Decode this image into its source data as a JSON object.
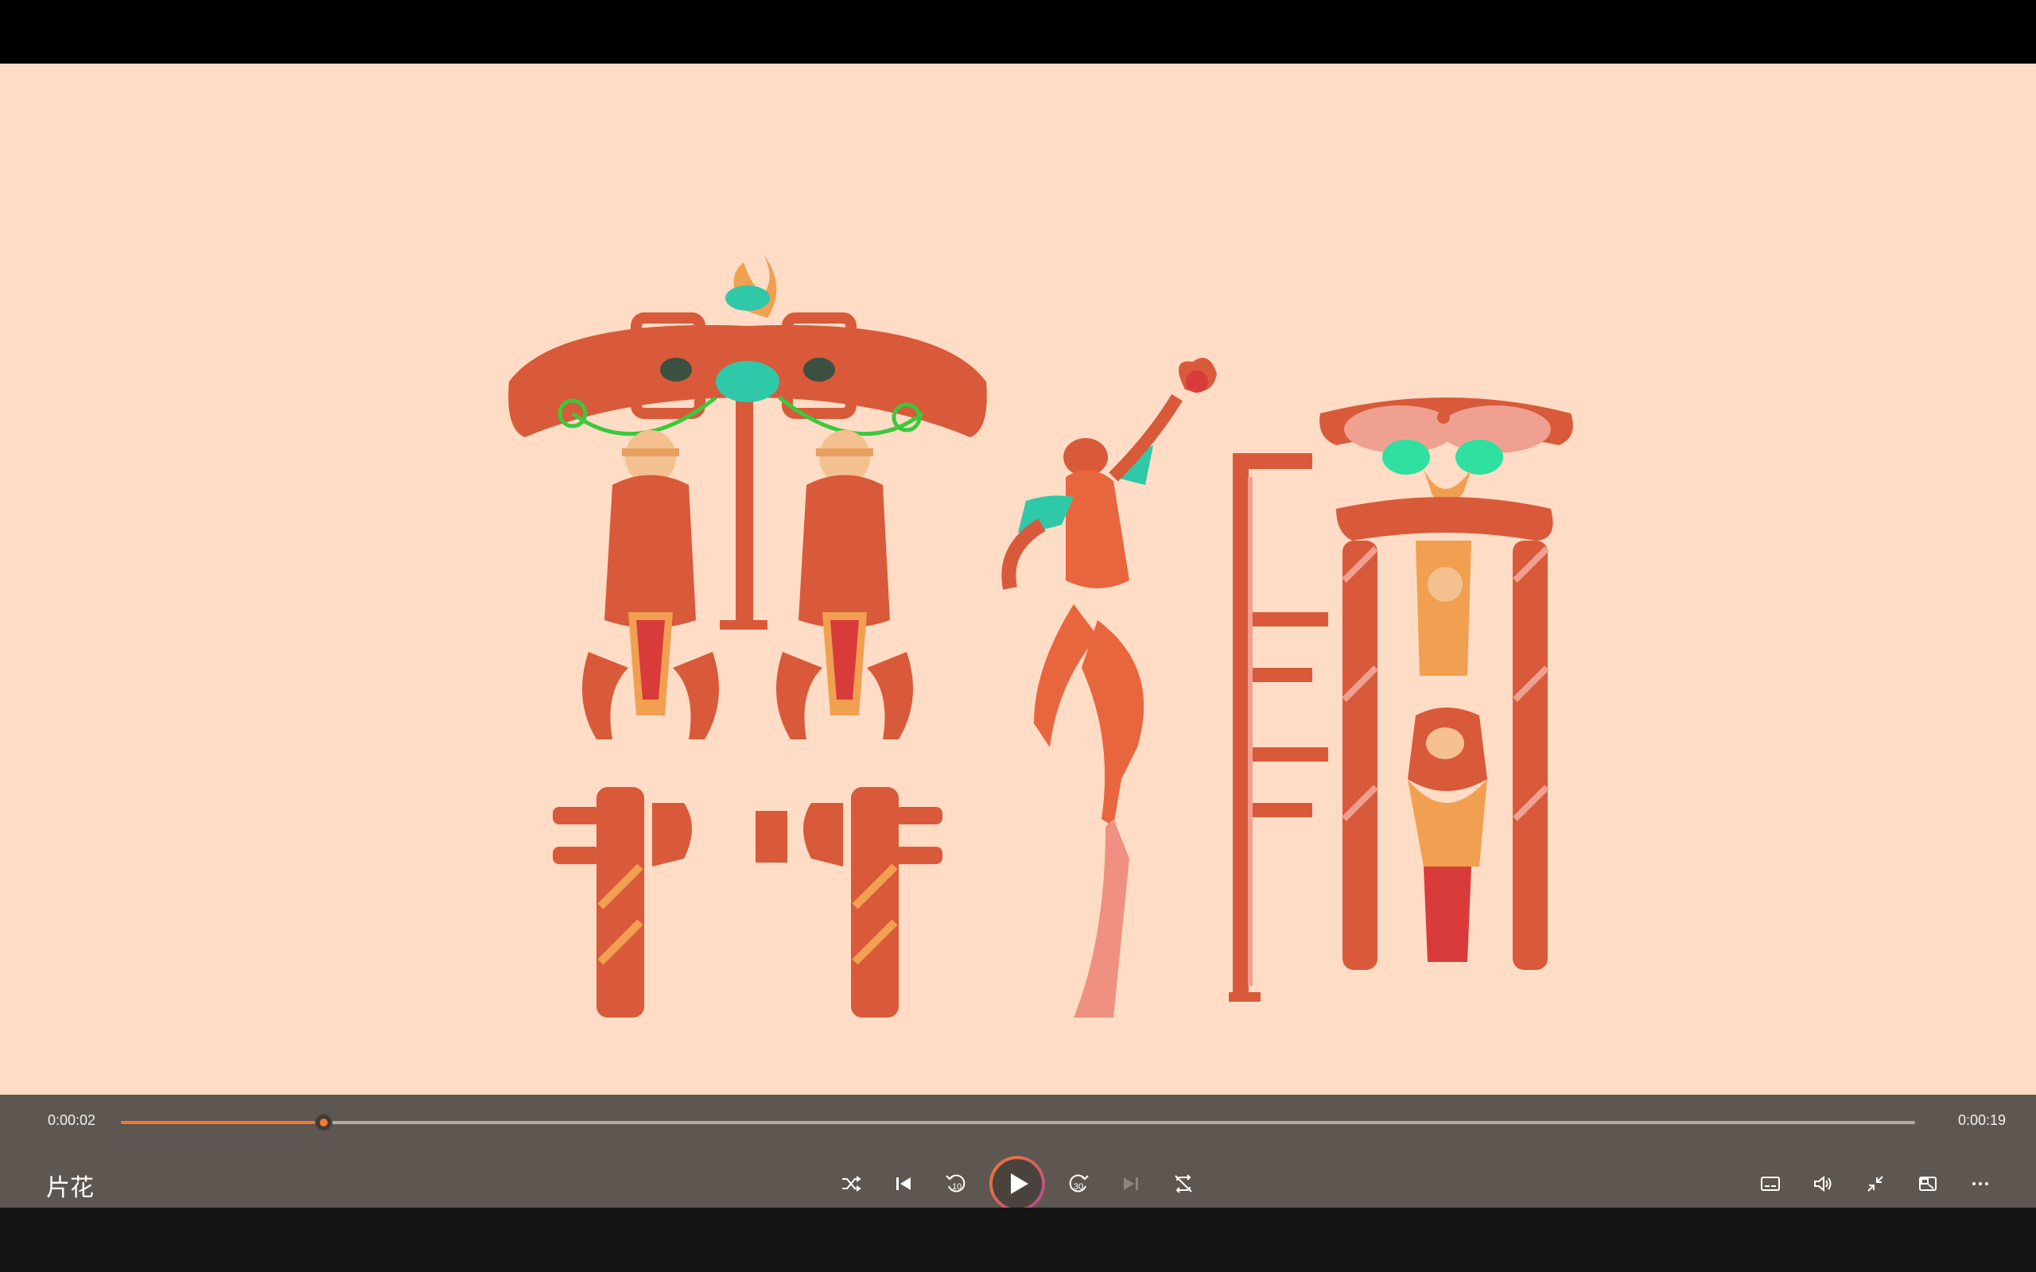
{
  "player": {
    "title": "片花",
    "elapsed": "0:00:02",
    "duration": "0:00:19",
    "progress_fraction": 0.113
  },
  "colors": {
    "accent": "#F07A30",
    "video_background": "#FFDCC6",
    "controls_background": "#5E5650"
  },
  "controls": {
    "center": [
      {
        "icon": "shuffle-icon"
      },
      {
        "icon": "previous-track-icon"
      },
      {
        "icon": "skip-back-10-icon",
        "label": "10"
      },
      {
        "icon": "play-icon"
      },
      {
        "icon": "skip-forward-30-icon",
        "label": "30"
      },
      {
        "icon": "next-track-icon"
      },
      {
        "icon": "repeat-icon"
      }
    ],
    "right": [
      {
        "icon": "subtitles-icon"
      },
      {
        "icon": "volume-icon"
      },
      {
        "icon": "exit-fullscreen-icon"
      },
      {
        "icon": "mini-player-icon"
      },
      {
        "icon": "more-options-icon"
      }
    ]
  }
}
